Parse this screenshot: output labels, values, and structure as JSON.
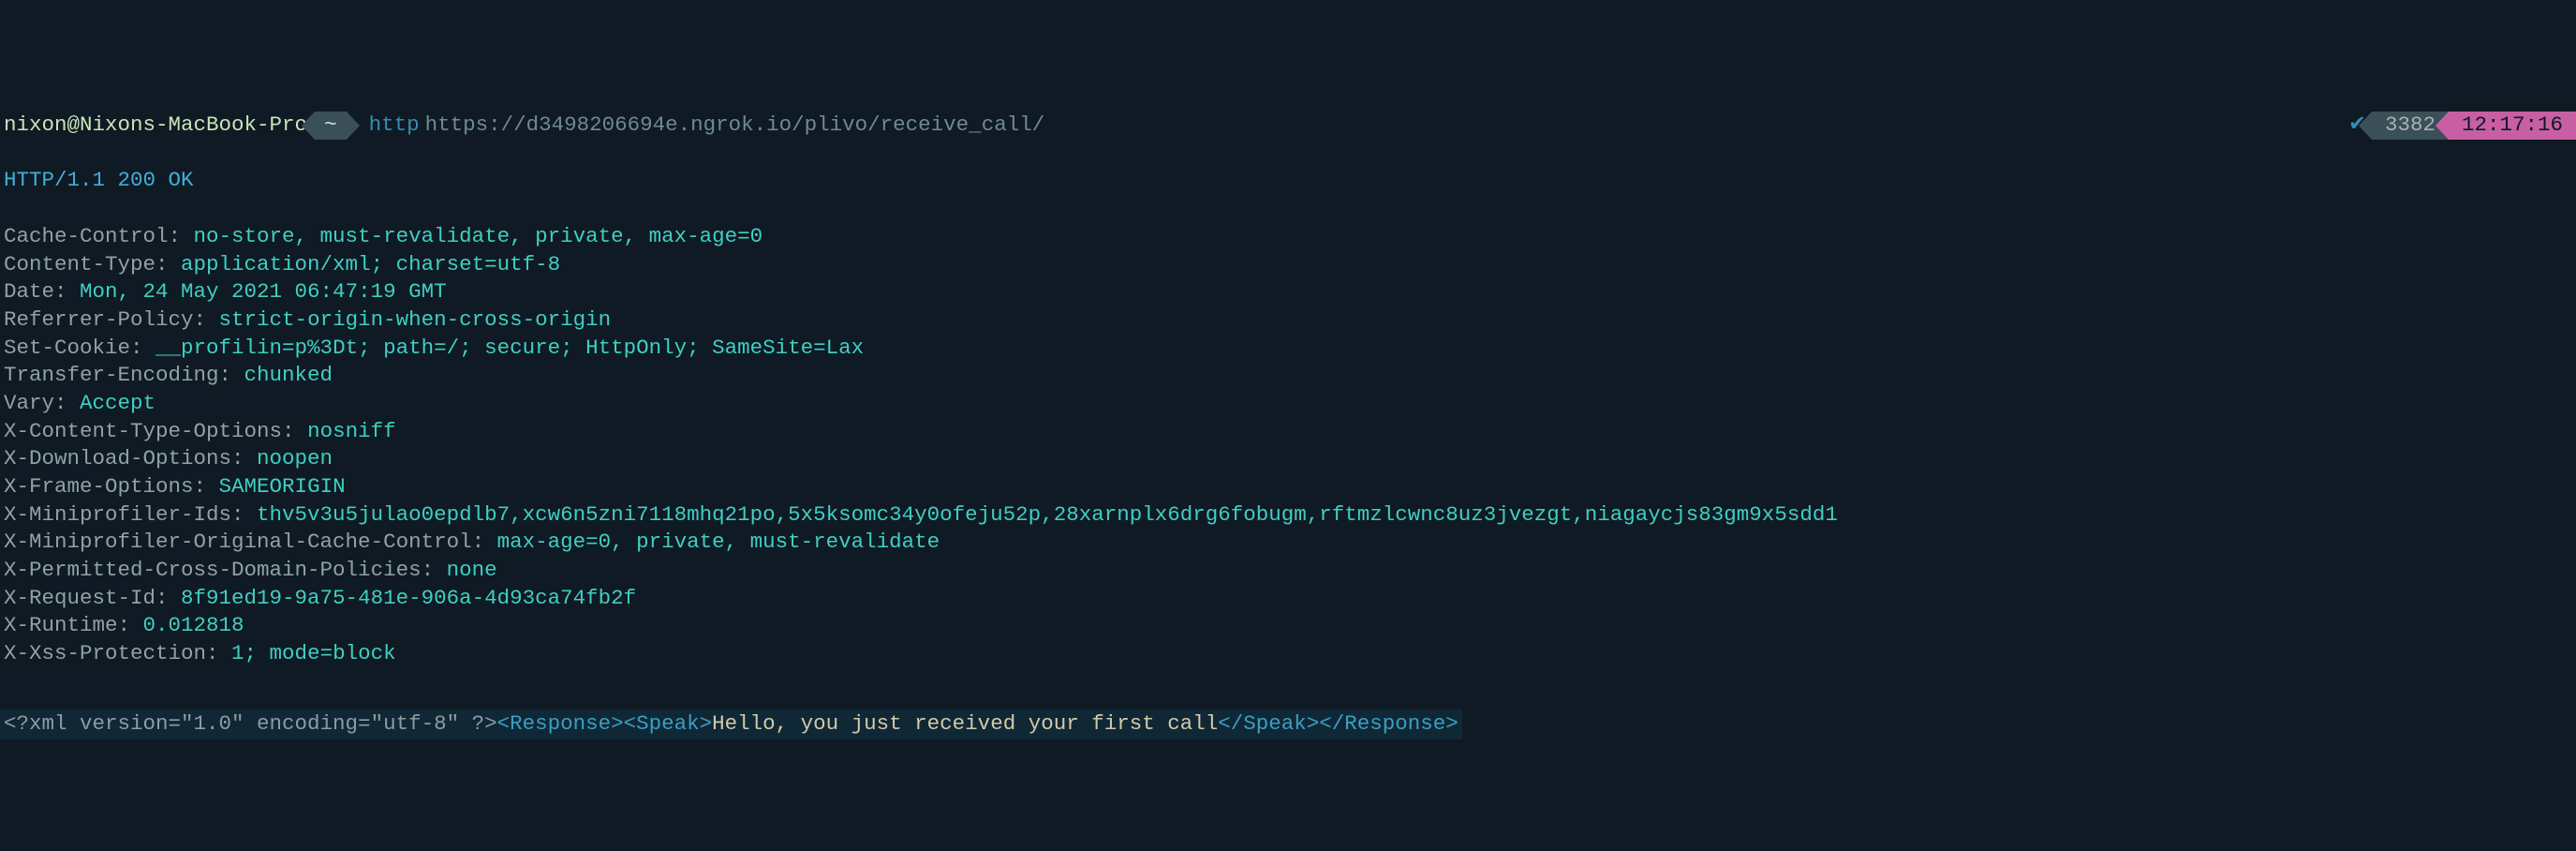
{
  "prompt": {
    "user_host": "nixon@Nixons-MacBook-Pro",
    "cwd": "~",
    "cmd_bin": "http",
    "cmd_arg": "https://d3498206694e.ngrok.io/plivo/receive_call/"
  },
  "status_right": {
    "check": "✔",
    "count": "3382",
    "time": "12:17:16"
  },
  "response": {
    "status_line": "HTTP/1.1 200 OK",
    "headers": [
      {
        "k": "Cache-Control",
        "v": "no-store, must-revalidate, private, max-age=0"
      },
      {
        "k": "Content-Type",
        "v": "application/xml; charset=utf-8"
      },
      {
        "k": "Date",
        "v": "Mon, 24 May 2021 06:47:19 GMT"
      },
      {
        "k": "Referrer-Policy",
        "v": "strict-origin-when-cross-origin"
      },
      {
        "k": "Set-Cookie",
        "v": "__profilin=p%3Dt; path=/; secure; HttpOnly; SameSite=Lax"
      },
      {
        "k": "Transfer-Encoding",
        "v": "chunked"
      },
      {
        "k": "Vary",
        "v": "Accept"
      },
      {
        "k": "X-Content-Type-Options",
        "v": "nosniff"
      },
      {
        "k": "X-Download-Options",
        "v": "noopen"
      },
      {
        "k": "X-Frame-Options",
        "v": "SAMEORIGIN"
      },
      {
        "k": "X-Miniprofiler-Ids",
        "v": "thv5v3u5julao0epdlb7,xcw6n5zni7118mhq21po,5x5ksomc34y0ofeju52p,28xarnplx6drg6fobugm,rftmzlcwnc8uz3jvezgt,niagaycjs83gm9x5sdd1"
      },
      {
        "k": "X-Miniprofiler-Original-Cache-Control",
        "v": "max-age=0, private, must-revalidate"
      },
      {
        "k": "X-Permitted-Cross-Domain-Policies",
        "v": "none"
      },
      {
        "k": "X-Request-Id",
        "v": "8f91ed19-9a75-481e-906a-4d93ca74fb2f"
      },
      {
        "k": "X-Runtime",
        "v": "0.012818"
      },
      {
        "k": "X-Xss-Protection",
        "v": "1; mode=block"
      }
    ]
  },
  "body": {
    "xml_decl": "<?xml version=\"1.0\" encoding=\"utf-8\" ?>",
    "open1": "<Response>",
    "open2": "<Speak>",
    "text": "Hello, you just received your first call",
    "close2": "</Speak>",
    "close1": "</Response>"
  }
}
